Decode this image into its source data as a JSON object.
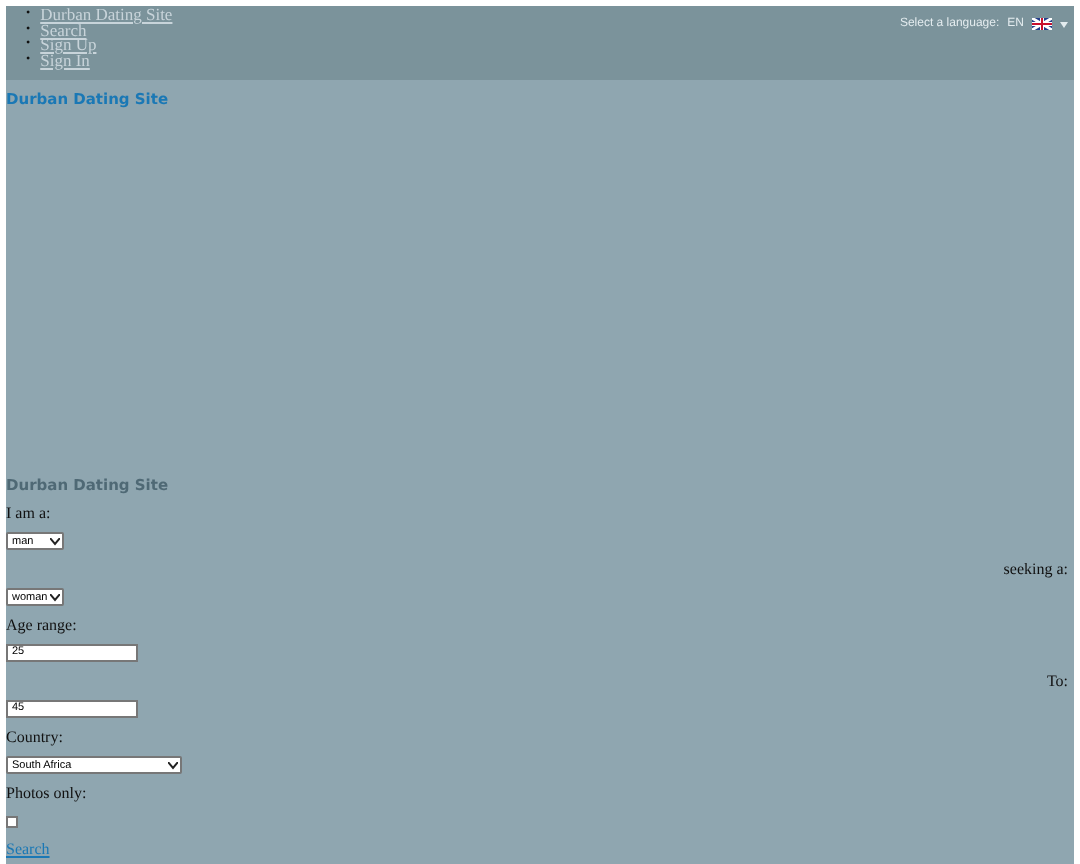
{
  "nav": {
    "items": [
      {
        "marker": "•",
        "label": "Durban Dating Site"
      },
      {
        "marker": "•",
        "label": "Search"
      },
      {
        "marker": "•",
        "label": "Sign Up"
      },
      {
        "marker": "•",
        "label": "Sign In"
      }
    ]
  },
  "language": {
    "label": "Select a language:",
    "value": "EN"
  },
  "site_title": "Durban Dating Site",
  "search_form": {
    "title": "Durban Dating Site",
    "i_am": {
      "label": "I am a:",
      "value": "man"
    },
    "seeking": {
      "label": "seeking a:",
      "value": "woman"
    },
    "age": {
      "label": "Age range:",
      "from": "25",
      "to_label": "To:",
      "to": "45"
    },
    "country": {
      "label": "Country:",
      "value": "South Africa"
    },
    "photos": {
      "label": "Photos only:",
      "checked": false
    },
    "submit": "Search"
  }
}
